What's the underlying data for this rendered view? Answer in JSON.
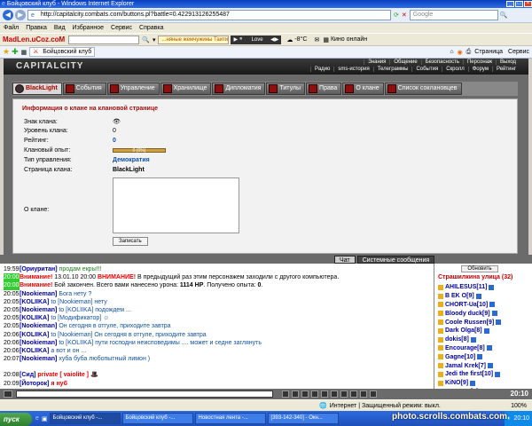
{
  "window": {
    "title": "Бойцовский клуб - Windows Internet Explorer"
  },
  "address": {
    "url": "http://capitalcity.combats.com/buttons.pl?battle=0.422913126255487",
    "search_placeholder": "Google"
  },
  "menu": [
    "Файл",
    "Правка",
    "Вид",
    "Избранное",
    "Сервис",
    "Справка"
  ],
  "toolbar": {
    "logo": "MadLen.uCoz.coM",
    "ticker": "...няные жемчужины Таити",
    "song": "Love",
    "temp": "-8°C",
    "radio": "Кино онлайн"
  },
  "browser_tab": {
    "label": "Бойцовский клуб",
    "page_menu": "Страница",
    "tools_menu": "Сервис"
  },
  "game": {
    "brand": "CAPITALCITY",
    "topnav1": [
      "Знания",
      "Общение",
      "Безопасность",
      "Персонаж",
      "Выход"
    ],
    "topnav2": [
      "Радио",
      "sms-история",
      "Телеграммы",
      "События",
      "Скролл",
      "Форум",
      "Рейтинг"
    ],
    "tabs": [
      "BlackLight",
      "События",
      "Управление",
      "Хранилище",
      "Дипломатия",
      "Титулы",
      "Права",
      "О клане",
      "Список соклановцев"
    ],
    "panel": {
      "title": "Информация о клане на клановой странице",
      "rows": [
        {
          "k": "Знак клана:",
          "v": ""
        },
        {
          "k": "Уровень клана:",
          "v": "0"
        },
        {
          "k": "Рейтинг:",
          "v": "0"
        },
        {
          "k": "Клановый опыт:",
          "v": "",
          "bar_label": "0 (0%)",
          "progress": 0
        },
        {
          "k": "Тип управления:",
          "v": "Демократия"
        },
        {
          "k": "Страница клана:",
          "v": "BlackLight"
        }
      ],
      "about_label": "О клане:",
      "save_btn": "Записать"
    }
  },
  "chat": {
    "tabs": [
      "Чат",
      "Системные сообщения"
    ],
    "lines": [
      {
        "t": "19:59",
        "hl": false,
        "parts": [
          {
            "c": "nm",
            "x": "[Ориуритан]"
          },
          {
            "c": "grn",
            "x": " продам екры!!!"
          }
        ]
      },
      {
        "t": "20:00",
        "hl": true,
        "parts": [
          {
            "c": "sys",
            "x": "Внимание!"
          },
          {
            "c": "",
            "x": " 13.01.10 20:00 "
          },
          {
            "c": "sys",
            "x": "ВНИМАНИЕ!"
          },
          {
            "c": "",
            "x": " В предыдущий раз этим персонажем заходили с другого компьютера."
          }
        ]
      },
      {
        "t": "20:00",
        "hl": true,
        "parts": [
          {
            "c": "sys",
            "x": "Внимание!"
          },
          {
            "c": "",
            "x": " Бой закончен. Всего вами нанесено урона: "
          },
          {
            "c": "b",
            "x": "1114 HP"
          },
          {
            "c": "",
            "x": ". Получено опыта: "
          },
          {
            "c": "b",
            "x": "0"
          },
          {
            "c": "",
            "x": "."
          }
        ]
      },
      {
        "t": "20:05",
        "hl": false,
        "parts": [
          {
            "c": "nm",
            "x": "[Nookieman]"
          },
          {
            "c": "blue",
            "x": " Бога нету ?"
          }
        ]
      },
      {
        "t": "20:05",
        "hl": false,
        "parts": [
          {
            "c": "nm",
            "x": "[KOLIIKA]"
          },
          {
            "c": "blue",
            "x": " to [Nookieman] нету"
          }
        ]
      },
      {
        "t": "20:05",
        "hl": false,
        "parts": [
          {
            "c": "nm",
            "x": "[Nookieman]"
          },
          {
            "c": "blue",
            "x": " to [KOLIIKA] подождем ..."
          }
        ]
      },
      {
        "t": "20:05",
        "hl": false,
        "parts": [
          {
            "c": "nm",
            "x": "[KOLIIKA]"
          },
          {
            "c": "blue",
            "x": " to [Модификатор] ☺"
          }
        ]
      },
      {
        "t": "20:05",
        "hl": false,
        "parts": [
          {
            "c": "nm",
            "x": "[Nookieman]"
          },
          {
            "c": "blue",
            "x": " Он сегодня в отгуле, приходите завтра"
          }
        ]
      },
      {
        "t": "20:06",
        "hl": false,
        "parts": [
          {
            "c": "nm",
            "x": "[KOLIIKA]"
          },
          {
            "c": "blue",
            "x": " to [Nookieman] Он сегодня в отгуле, приходите завтра"
          }
        ]
      },
      {
        "t": "20:06",
        "hl": false,
        "parts": [
          {
            "c": "nm",
            "x": "[Nookieman]"
          },
          {
            "c": "blue",
            "x": " to [KOLIIKA] пути господни неисповедимы .... может и седне заглянуть"
          }
        ]
      },
      {
        "t": "20:06",
        "hl": false,
        "parts": [
          {
            "c": "nm",
            "x": "[KOLIIKA]"
          },
          {
            "c": "blue",
            "x": " а вот и он ..."
          }
        ]
      },
      {
        "t": "20:07",
        "hl": false,
        "parts": [
          {
            "c": "nm",
            "x": "[Nookieman]"
          },
          {
            "c": "blue",
            "x": " хуба буба любопытный лимон )"
          }
        ]
      },
      {
        "t": "",
        "hl": false,
        "parts": [
          {
            "c": "",
            "x": ""
          }
        ]
      },
      {
        "t": "20:08",
        "hl": false,
        "parts": [
          {
            "c": "nm",
            "x": "[Сид]"
          },
          {
            "c": "sys",
            "x": " private [ vaiolite ]"
          },
          {
            "c": "",
            "x": " 🎩"
          }
        ]
      },
      {
        "t": "20:09",
        "hl": false,
        "parts": [
          {
            "c": "nm",
            "x": "[Йоторок]"
          },
          {
            "c": "sys",
            "x": " я нуб"
          }
        ]
      },
      {
        "t": "20:10",
        "hl": false,
        "parts": [
          {
            "c": "nm",
            "x": "[vaiolite]"
          },
          {
            "c": "sys",
            "x": " private [ Сид ]"
          },
          {
            "c": "",
            "x": " здрова"
          }
        ]
      }
    ]
  },
  "users": {
    "refresh": "Обновить",
    "street": "Страшилкина улица (32)",
    "list": [
      "AHILESUS[11]",
      "B EK O[9]",
      "CHORT-Ua[10]",
      "Bloody duck[9]",
      "Coole Russen[9]",
      "Dark Olga[8]",
      "dokis[8]",
      "Encourage[8]",
      "Gagne[10]",
      "Jamal Krek[7]",
      "Jedi the first[10]",
      "KiNO[9]",
      "KOLIIKA[9]"
    ]
  },
  "clock": "20:10",
  "status": {
    "zone": "Интернет | Защищенный режим: выкл.",
    "zoom": "100%"
  },
  "taskbar": {
    "start": "пуск",
    "tasks": [
      "Бойцовский клуб -...",
      "Бойцовский клуб -...",
      "Новостная лента -...",
      "[393-142-340] - Окн..."
    ],
    "time": "20:10"
  },
  "watermark": "photo.scrolls.combats.com"
}
